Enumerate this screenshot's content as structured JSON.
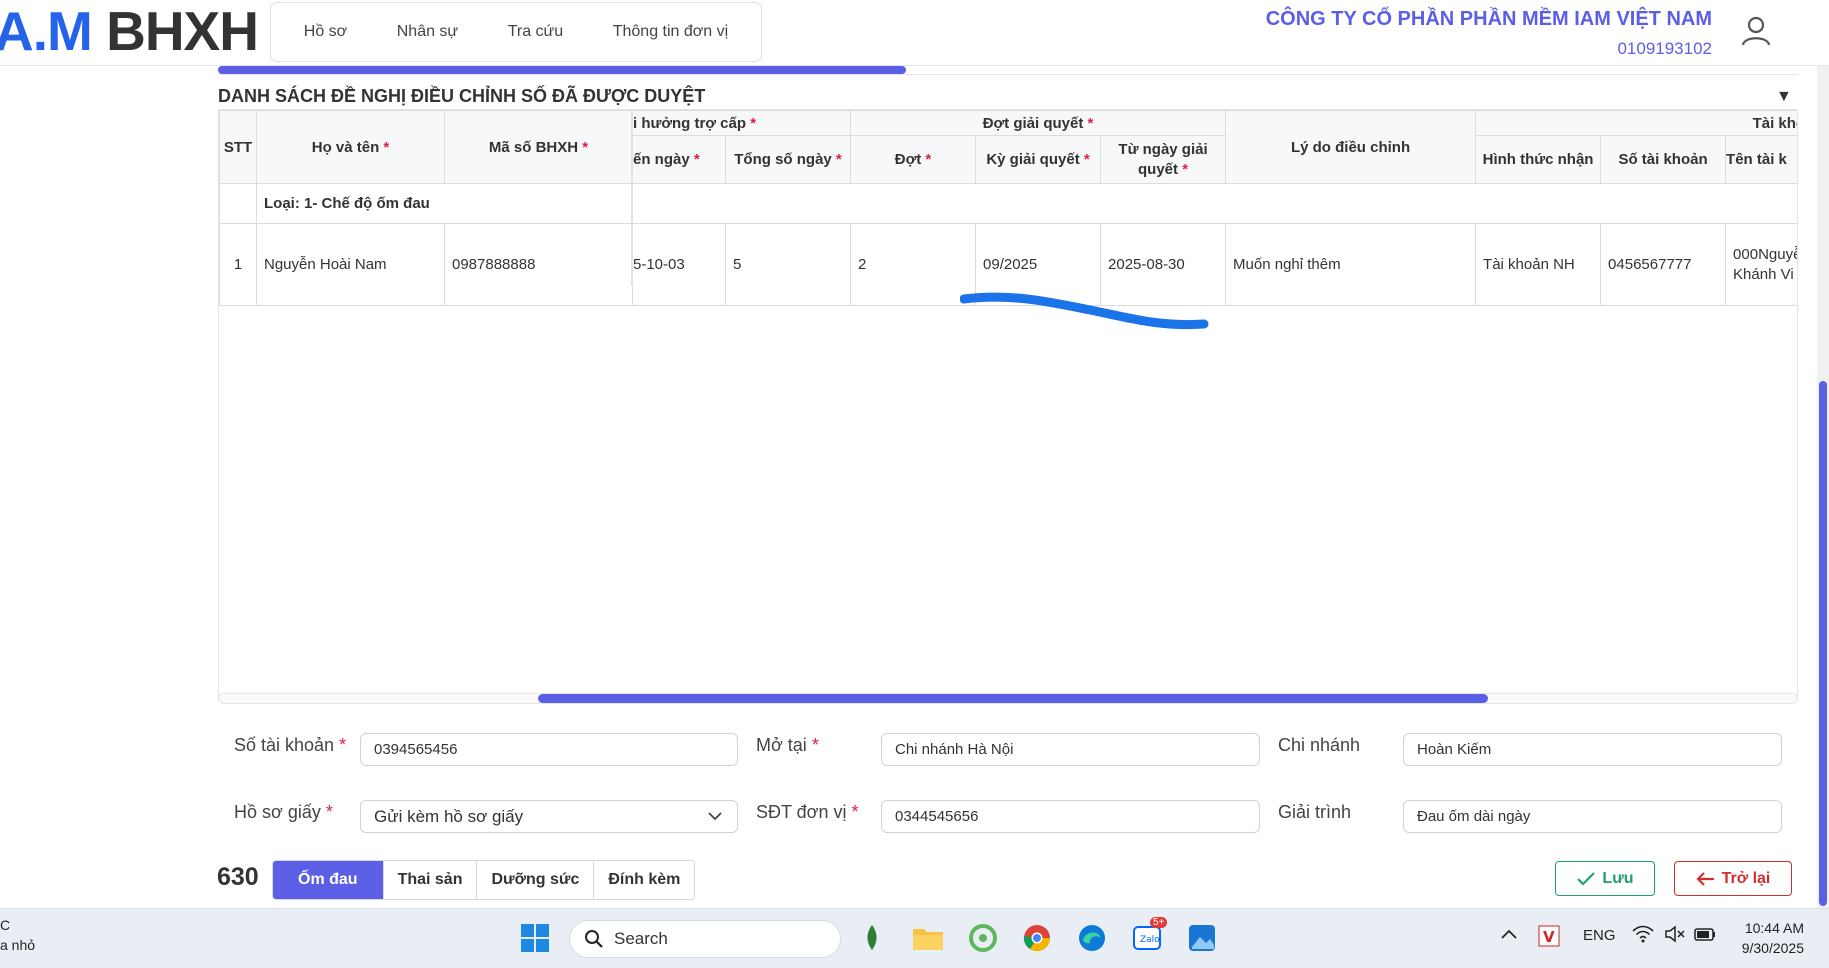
{
  "app": {
    "logo_part1": "A.M",
    "logo_part2": "BHXH"
  },
  "nav": [
    "Hồ sơ",
    "Nhân sự",
    "Tra cứu",
    "Thông tin đơn vị"
  ],
  "company": {
    "name": "CÔNG TY CỔ PHẦN PHẦN MỀM IAM VIỆT NAM",
    "code": "0109193102"
  },
  "section_title": "DANH SÁCH ĐỀ NGHỊ ĐIỀU CHỈNH SỐ ĐÃ ĐƯỢC DUYỆT",
  "table": {
    "group_headers": {
      "benefit": "i hưởng trợ cấp",
      "settle": "Đợt giải quyết",
      "account": "Tài kho"
    },
    "headers": {
      "stt": "STT",
      "name": "Họ và tên",
      "bhxh": "Mã số BHXH",
      "to_date": "ến ngày",
      "total_days": "Tổng số ngày",
      "batch": "Đợt",
      "period": "Kỳ giải quyết",
      "from_date_1": "Từ ngày giải",
      "from_date_2": "quyết",
      "reason": "Lý do điều chỉnh",
      "receive": "Hình thức nhận",
      "acc_no": "Số tài khoản",
      "acc_name": "Tên tài k"
    },
    "required_mark": "*",
    "group_label": "Loại: 1- Chế độ ốm đau",
    "row": {
      "stt": "1",
      "name": "Nguyễn Hoài Nam",
      "bhxh": "0987888888",
      "to_date": "5-10-03",
      "total_days": "5",
      "batch": "2",
      "period": "09/2025",
      "from_date": "2025-08-30",
      "reason": "Muốn nghỉ thêm",
      "receive": "Tài khoản NH",
      "acc_no": "0456567777",
      "acc_name_1": "000Nguyễ",
      "acc_name_2": "Khánh Vi"
    }
  },
  "form": {
    "account_label": "Số tài khoản",
    "account_value": "0394565456",
    "open_at_label": "Mở tại",
    "open_at_value": "Chi nhánh Hà Nội",
    "branch_label": "Chi nhánh",
    "branch_value": "Hoàn Kiếm",
    "paper_label": "Hồ sơ giấy",
    "paper_value": "Gửi kèm hồ sơ giấy",
    "phone_label": "SĐT đơn vị",
    "phone_value": "0344545656",
    "explain_label": "Giải trình",
    "explain_value": "Đau ốm dài ngày"
  },
  "record_count": "630",
  "tabs": [
    "Ốm đau",
    "Thai sản",
    "Dưỡng sức",
    "Đính kèm"
  ],
  "buttons": {
    "save": "Lưu",
    "back": "Trở lại"
  },
  "taskbar": {
    "left_line1": "C",
    "left_line2": "a nhỏ",
    "search_placeholder": "Search",
    "zalo_badge": "5+",
    "lang": "ENG",
    "time": "10:44 AM",
    "date": "9/30/2025"
  },
  "colors": {
    "accent": "#5b5fe6",
    "save": "#22a06b",
    "back": "#d32f2f",
    "required": "#e11d48",
    "scribble": "#1a73e8"
  },
  "icons": [
    "user-icon",
    "collapse-triangle-icon",
    "chevron-down-icon",
    "check-icon",
    "arrow-left-icon",
    "search-icon",
    "windows-start-icon",
    "file-explorer-icon",
    "chrome-icon",
    "edge-icon"
  ]
}
